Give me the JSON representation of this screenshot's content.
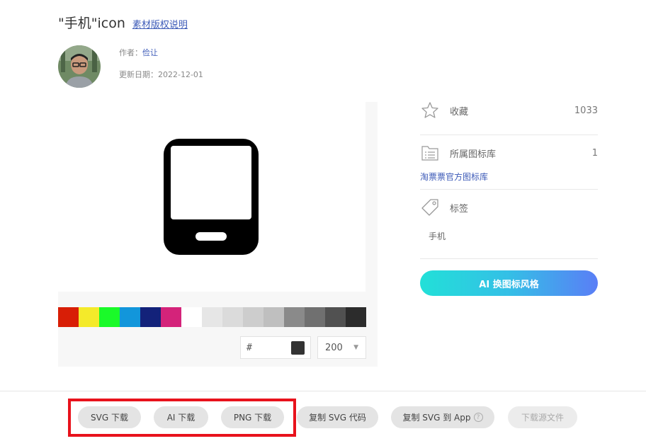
{
  "header": {
    "title": "\"手机\"icon",
    "license_link": "素材版权说明"
  },
  "meta": {
    "author_label": "作者：",
    "author_name": "俭让",
    "date_label": "更新日期：",
    "date_value": "2022-12-01"
  },
  "preview": {
    "icon": "mobile-phone-icon",
    "swatches": [
      "#d81e06",
      "#f4ea2a",
      "#1afa29",
      "#1296db",
      "#13227a",
      "#d4237a",
      "#ffffff",
      "#e6e6e6",
      "#dbdbdb",
      "#cdcdcd",
      "#bfbfbf",
      "#8a8a8a",
      "#707070",
      "#515151",
      "#2c2c2c"
    ],
    "hex_prefix": "#",
    "current_color": "#333333",
    "size_value": "200",
    "size_chevron": "▼"
  },
  "sidebar": {
    "favorites_label": "收藏",
    "favorites_count": "1033",
    "library_label": "所属图标库",
    "library_count": "1",
    "library_link": "淘票票官方图标库",
    "tags_label": "标签",
    "tags": [
      "手机"
    ],
    "ai_button": "AI 换图标风格"
  },
  "actions": {
    "svg_download": "SVG 下载",
    "ai_download": "AI 下载",
    "png_download": "PNG 下载",
    "copy_svg_code": "复制 SVG 代码",
    "copy_svg_app": "复制 SVG 到 App",
    "help_glyph": "?",
    "download_source": "下载源文件"
  },
  "colors": {
    "accent": "#3d5bb8",
    "highlight": "#e8121c",
    "icon": "#000000"
  }
}
